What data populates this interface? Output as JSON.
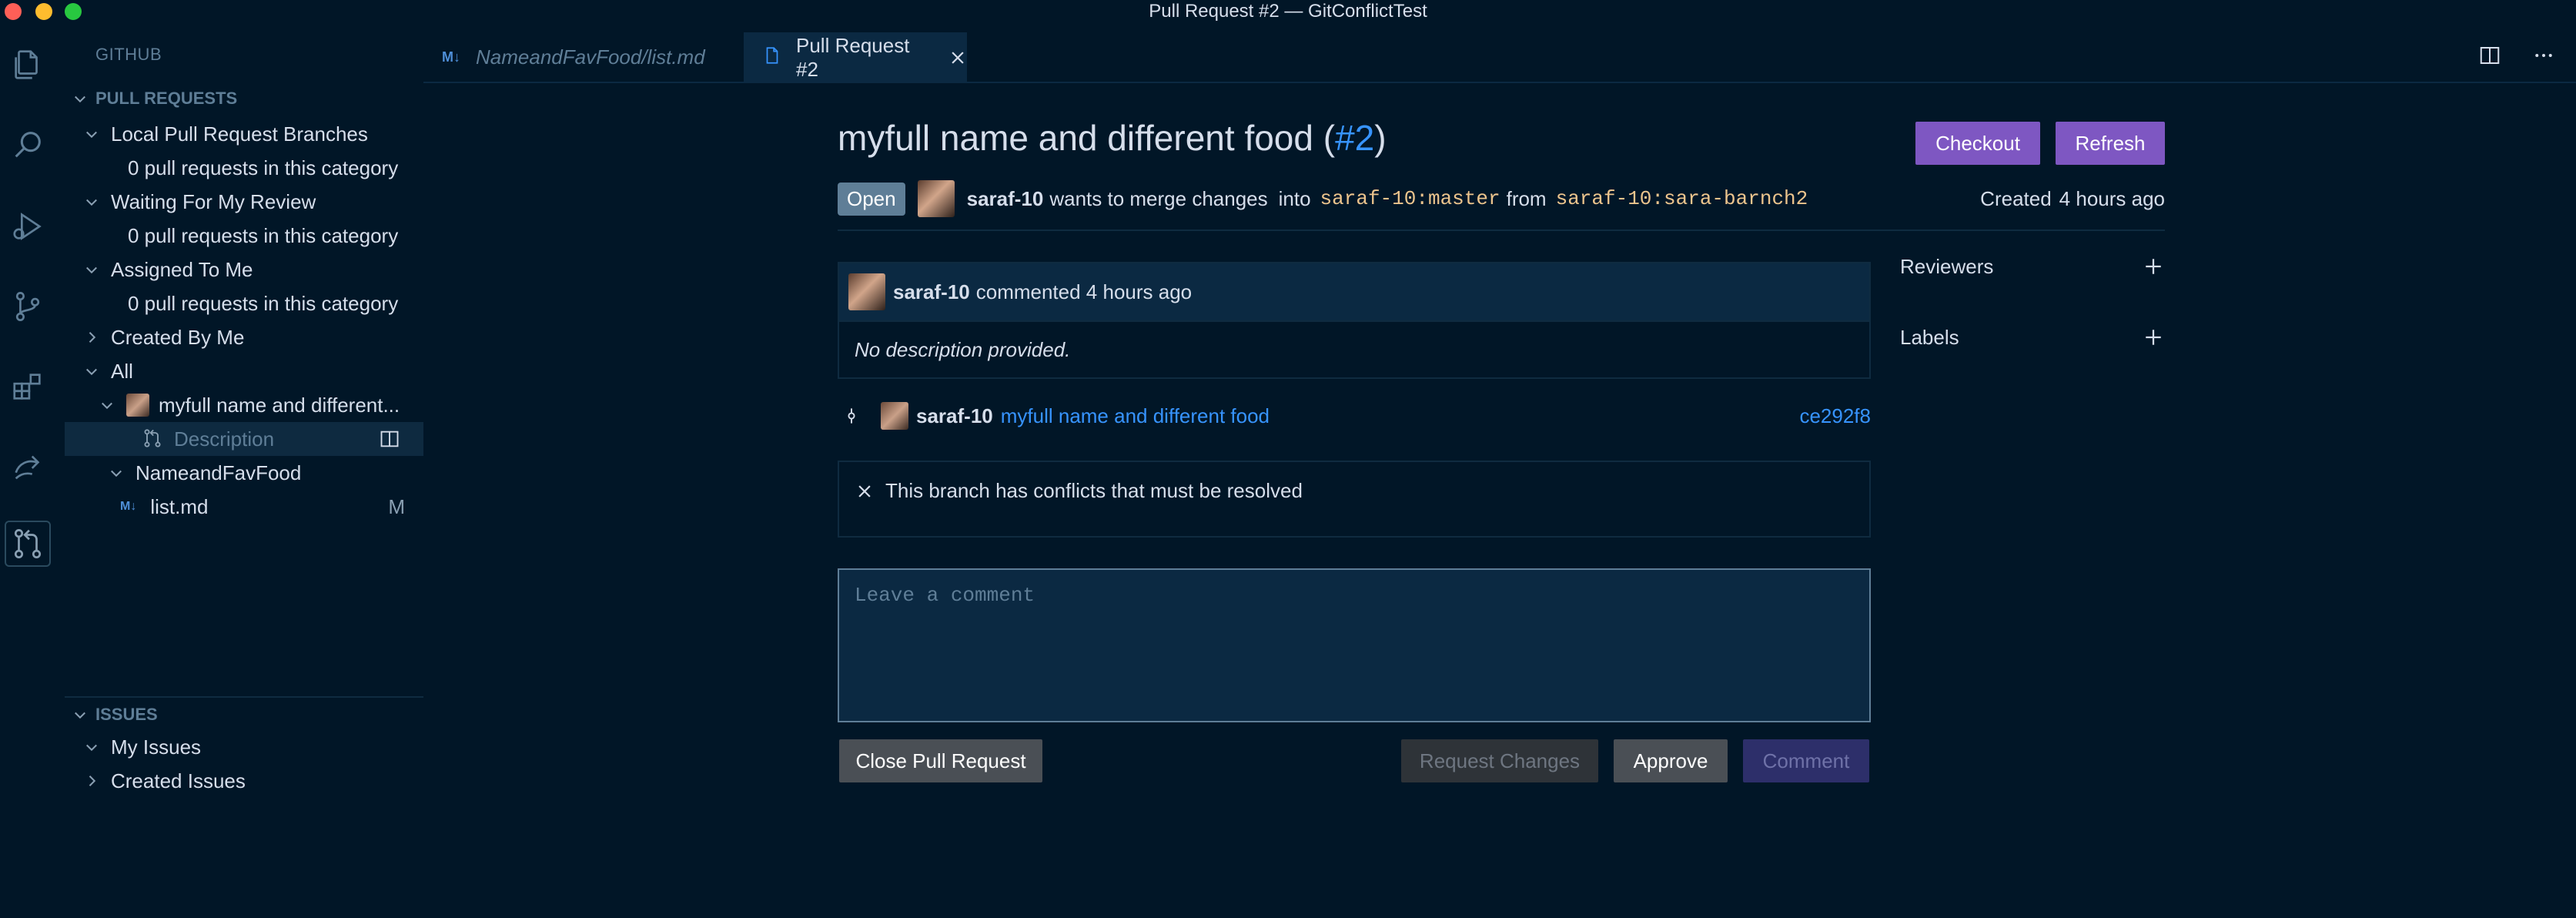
{
  "window": {
    "title": "Pull Request #2 — GitConflictTest"
  },
  "sidebar": {
    "header": "GITHUB",
    "pull_requests_section": "PULL REQUESTS",
    "issues_section": "ISSUES",
    "pr_items": {
      "local_branches": "Local Pull Request Branches",
      "local_empty": "0 pull requests in this category",
      "waiting_review": "Waiting For My Review",
      "waiting_empty": "0 pull requests in this category",
      "assigned": "Assigned To Me",
      "assigned_empty": "0 pull requests in this category",
      "created_by_me": "Created By Me",
      "all": "All",
      "pr_entry": "myfull name and different...",
      "description": "Description",
      "folder": "NameandFavFood",
      "file": "list.md",
      "file_status": "M"
    },
    "issue_items": {
      "my_issues": "My Issues",
      "created_issues": "Created Issues"
    }
  },
  "tabs": [
    {
      "label": "NameandFavFood/list.md",
      "icon": "M↓"
    },
    {
      "label": "Pull Request #2"
    }
  ],
  "pr": {
    "title": "myfull name and different food (",
    "number": "#2",
    "title_close": ")",
    "checkout_label": "Checkout",
    "refresh_label": "Refresh",
    "status": "Open",
    "author": "saraf-10",
    "merge_text": "wants to merge changes",
    "into_text": "into",
    "target_branch": "saraf-10:master",
    "from_text": "from",
    "source_branch": "saraf-10:sara-barnch2",
    "created_label": "Created",
    "created_time": "4 hours ago",
    "comment": {
      "author": "saraf-10",
      "meta": "commented 4 hours ago",
      "body": "No description provided."
    },
    "commit": {
      "author": "saraf-10",
      "message": "myfull name and different food",
      "hash": "ce292f8"
    },
    "conflict_message": "This branch has conflicts that must be resolved",
    "comment_placeholder": "Leave a comment",
    "close_pr_label": "Close Pull Request",
    "request_changes_label": "Request Changes",
    "approve_label": "Approve",
    "comment_label": "Comment",
    "reviewers_label": "Reviewers",
    "labels_label": "Labels"
  }
}
